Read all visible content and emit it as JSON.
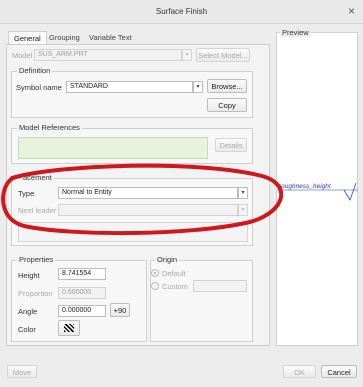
{
  "window": {
    "title": "Surface Finish",
    "close_glyph": "×"
  },
  "tabs": [
    "General",
    "Grouping",
    "Variable Text"
  ],
  "model": {
    "label": "Model",
    "value": "SUS_ARM.PRT",
    "button": "Select Model..."
  },
  "definition": {
    "title": "Definition",
    "symbol_label": "Symbol name",
    "symbol_value": "STANDARD",
    "browse": "Browse...",
    "copy": "Copy"
  },
  "model_references": {
    "title": "Model References",
    "details": "Details"
  },
  "placement": {
    "title": "Placement",
    "title_visible": "acement",
    "type_label": "Type",
    "type_value": "Normal to Entity",
    "next_leader_label": "Next leader",
    "next_leader_value": ""
  },
  "properties": {
    "title": "Properties",
    "height_label": "Height",
    "height_value": "8.741554",
    "proportion_label": "Proportion",
    "proportion_value": "0.600000",
    "angle_label": "Angle",
    "angle_value": "0.000000",
    "angle_button": "+90",
    "color_label": "Color"
  },
  "origin": {
    "title": "Origin",
    "default_label": "Default",
    "custom_label": "Custom"
  },
  "preview": {
    "title": "Preview",
    "symbol_text": "roughness_height"
  },
  "footer": {
    "move": "Move",
    "ok": "OK",
    "cancel": "Cancel"
  },
  "colors": {
    "annotation_circle": "#d0181c",
    "preview_symbol": "#2b3ad1",
    "green_field": "#e8f2dc"
  }
}
